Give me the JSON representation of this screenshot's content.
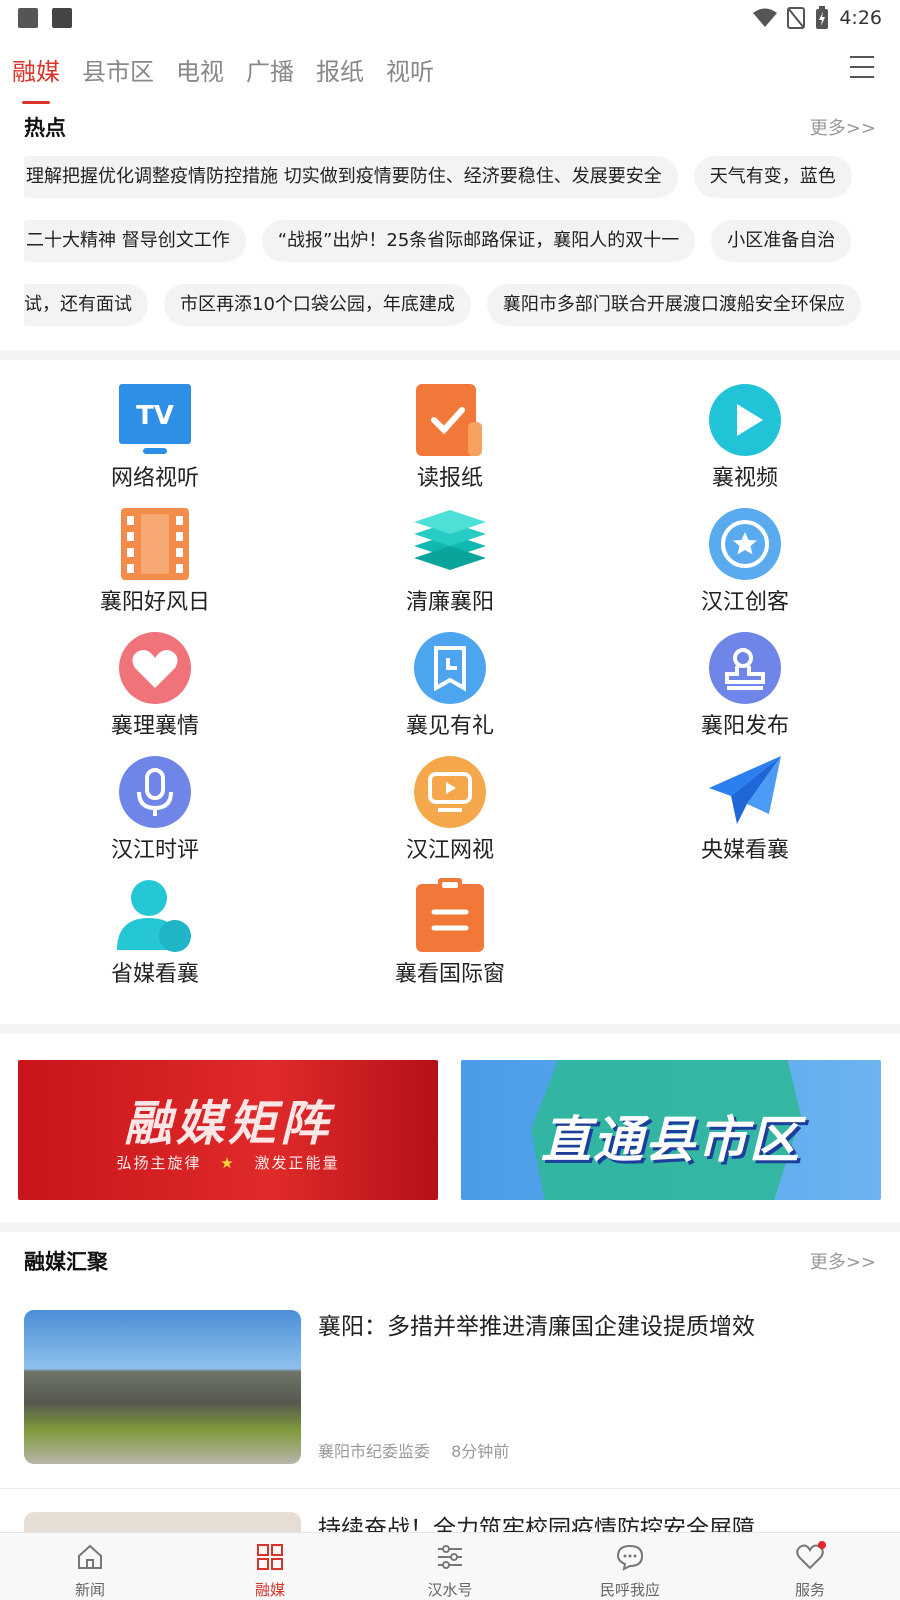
{
  "status": {
    "time": "4:26"
  },
  "tabs": [
    {
      "label": "融媒"
    },
    {
      "label": "县市区"
    },
    {
      "label": "电视"
    },
    {
      "label": "广播"
    },
    {
      "label": "报纸"
    },
    {
      "label": "视听"
    }
  ],
  "hot": {
    "title": "热点",
    "more": "更多>>",
    "rows": [
      [
        "理解把握优化调整疫情防控措施 切实做到疫情要防住、经济要稳住、发展要安全",
        "天气有变，蓝色"
      ],
      [
        "二十大精神   督导创文工作",
        "“战报”出炉！25条省际邮路保证，襄阳人的双十一",
        "小区准备自治"
      ],
      [
        "试，还有面试",
        "市区再添10个口袋公园，年底建成",
        "襄阳市多部门联合开展渡口渡船安全环保应"
      ]
    ]
  },
  "grid": [
    {
      "label": "网络视听",
      "icon": "tv-icon"
    },
    {
      "label": "读报纸",
      "icon": "newspaper-check-icon"
    },
    {
      "label": "襄视频",
      "icon": "play-icon"
    },
    {
      "label": "襄阳好风日",
      "icon": "film-icon"
    },
    {
      "label": "清廉襄阳",
      "icon": "layers-icon"
    },
    {
      "label": "汉江创客",
      "icon": "star-badge-icon"
    },
    {
      "label": "襄理襄情",
      "icon": "heart-icon"
    },
    {
      "label": "襄见有礼",
      "icon": "clock-bookmark-icon"
    },
    {
      "label": "襄阳发布",
      "icon": "stamp-icon"
    },
    {
      "label": "汉江时评",
      "icon": "microphone-icon"
    },
    {
      "label": "汉江网视",
      "icon": "video-screen-icon"
    },
    {
      "label": "央媒看襄",
      "icon": "paper-plane-icon"
    },
    {
      "label": "省媒看襄",
      "icon": "user-icon"
    },
    {
      "label": "襄看国际窗",
      "icon": "clipboard-icon"
    }
  ],
  "banners": {
    "left": {
      "title": "融媒矩阵",
      "sub_left": "弘扬主旋律",
      "sub_star": "★",
      "sub_right": "激发正能量"
    },
    "right": {
      "title": "直通县市区"
    }
  },
  "gather": {
    "title": "融媒汇聚",
    "more": "更多>>",
    "items": [
      {
        "title": "襄阳：多措并举推进清廉国企建设提质增效",
        "source": "襄阳市纪委监委",
        "time": "8分钟前"
      },
      {
        "title": "持续奋战！全力筑牢校园疫情防控安全屏障",
        "source": "",
        "time": ""
      }
    ]
  },
  "nav": [
    {
      "label": "新闻",
      "icon": "home-icon"
    },
    {
      "label": "融媒",
      "icon": "grid-icon"
    },
    {
      "label": "汉水号",
      "icon": "sliders-icon"
    },
    {
      "label": "民呼我应",
      "icon": "chat-icon"
    },
    {
      "label": "服务",
      "icon": "heart-outline-icon"
    }
  ],
  "colors": {
    "accent": "#d9342b",
    "chip_bg": "#f3f3f3"
  }
}
